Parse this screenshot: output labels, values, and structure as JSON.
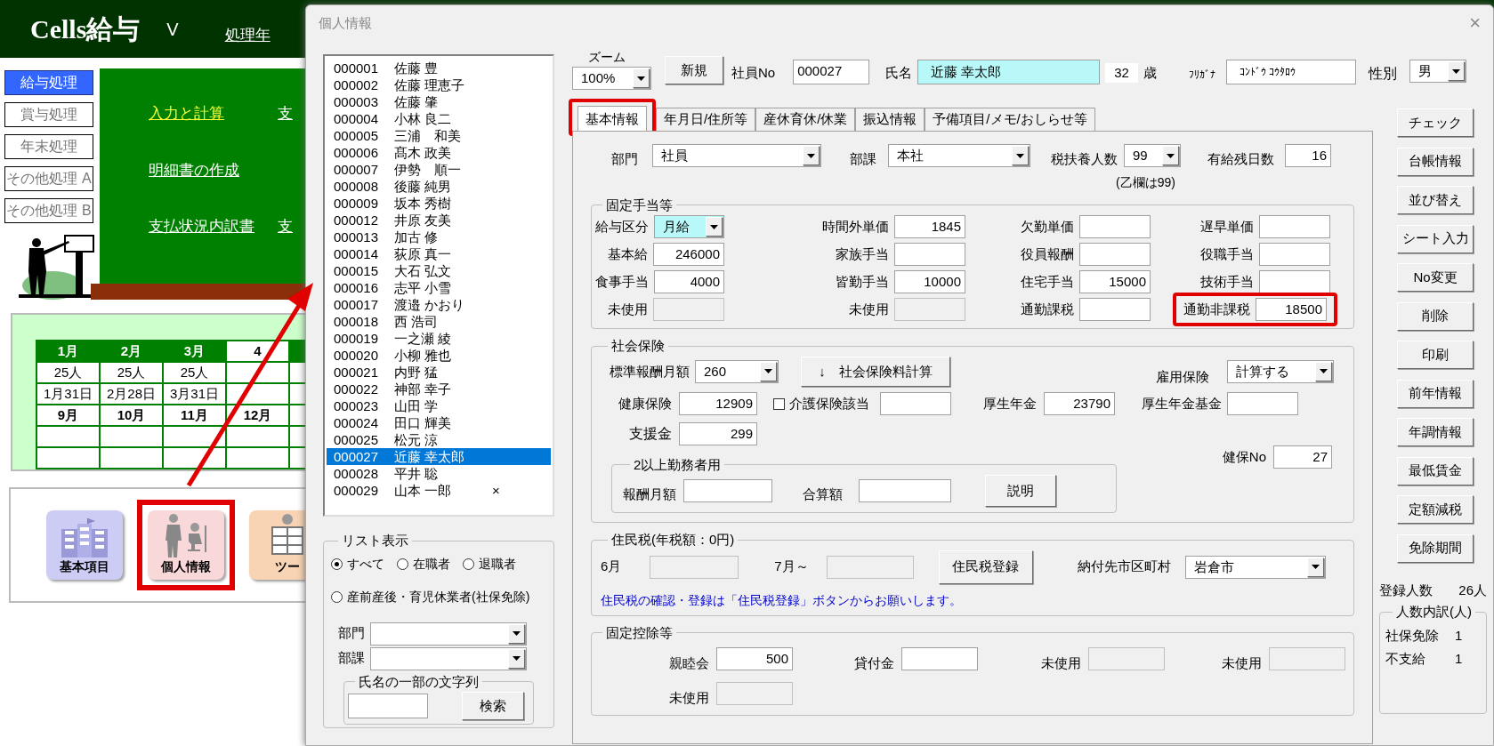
{
  "app": {
    "title": "Cells給与",
    "version_prefix": "V",
    "header_label": "処理年",
    "nav": [
      {
        "label": "給与処理",
        "selected": true
      },
      {
        "label": "賞与処理",
        "selected": false
      },
      {
        "label": "年末処理",
        "selected": false
      },
      {
        "label": "その他処理 A",
        "selected": false
      },
      {
        "label": "その他処理 B",
        "selected": false
      }
    ],
    "menu_rows": [
      {
        "links": [
          {
            "label": "入力と計算",
            "highlighted": true
          },
          {
            "label": "支",
            "highlighted": false
          }
        ]
      },
      {
        "links": [
          {
            "label": "明細書の作成",
            "highlighted": false
          }
        ]
      },
      {
        "links": [
          {
            "label": "支払状況内訳書",
            "highlighted": false
          },
          {
            "label": "支",
            "highlighted": false
          }
        ]
      }
    ],
    "calendar": [
      {
        "kind": "header",
        "cells": [
          {
            "text": "1月",
            "selected": false
          },
          {
            "text": "2月",
            "selected": false
          },
          {
            "text": "3月",
            "selected": false
          },
          {
            "text": "4",
            "selected": true
          }
        ]
      },
      {
        "kind": "data",
        "cells": [
          "25人",
          "25人",
          "25人"
        ]
      },
      {
        "kind": "data",
        "cells": [
          "1月31日",
          "2月28日",
          "3月31日"
        ]
      },
      {
        "kind": "month",
        "cells": [
          "9月",
          "10月",
          "11月",
          "12月"
        ]
      },
      {
        "kind": "blank"
      },
      {
        "kind": "blank"
      }
    ],
    "tools": [
      {
        "label": "基本項目",
        "kind": "building",
        "highlighted": false
      },
      {
        "label": "個人情報",
        "kind": "people",
        "highlighted": true
      },
      {
        "label": "ツー",
        "kind": "worker",
        "highlighted": false
      }
    ]
  },
  "dialog": {
    "title": "個人情報",
    "close": "×",
    "employees": [
      {
        "no": "000001",
        "name": "佐藤 豊",
        "selected": false
      },
      {
        "no": "000002",
        "name": "佐藤 理恵子",
        "selected": false
      },
      {
        "no": "000003",
        "name": "佐藤 肇",
        "selected": false
      },
      {
        "no": "000004",
        "name": "小林 良二",
        "selected": false
      },
      {
        "no": "000005",
        "name": "三浦　和美",
        "selected": false
      },
      {
        "no": "000006",
        "name": "髙木 政美",
        "selected": false
      },
      {
        "no": "000007",
        "name": "伊勢　順一",
        "selected": false
      },
      {
        "no": "000008",
        "name": "後藤 純男",
        "selected": false
      },
      {
        "no": "000009",
        "name": "坂本 秀樹",
        "selected": false
      },
      {
        "no": "000012",
        "name": "井原 友美",
        "selected": false
      },
      {
        "no": "000013",
        "name": "加古 修",
        "selected": false
      },
      {
        "no": "000014",
        "name": "荻原 真一",
        "selected": false
      },
      {
        "no": "000015",
        "name": "大石 弘文",
        "selected": false
      },
      {
        "no": "000016",
        "name": "志平 小雪",
        "selected": false
      },
      {
        "no": "000017",
        "name": "渡邉 かおり",
        "selected": false
      },
      {
        "no": "000018",
        "name": "西 浩司",
        "selected": false
      },
      {
        "no": "000019",
        "name": "一之瀬 綾",
        "selected": false
      },
      {
        "no": "000020",
        "name": "小柳 雅也",
        "selected": false
      },
      {
        "no": "000021",
        "name": "内野 猛",
        "selected": false
      },
      {
        "no": "000022",
        "name": "神部 幸子",
        "selected": false
      },
      {
        "no": "000023",
        "name": "山田 学",
        "selected": false
      },
      {
        "no": "000024",
        "name": "田口 輝美",
        "selected": false
      },
      {
        "no": "000025",
        "name": "松元 涼",
        "selected": false
      },
      {
        "no": "000027",
        "name": "近藤 幸太郎",
        "selected": true
      },
      {
        "no": "000028",
        "name": "平井 聡",
        "selected": false
      },
      {
        "no": "000029",
        "name": "山本 一郎",
        "selected": false,
        "note": "×"
      }
    ],
    "list_filter": {
      "title": "リスト表示",
      "radios": [
        {
          "label": "すべて",
          "selected": true
        },
        {
          "label": "在職者",
          "selected": false
        },
        {
          "label": "退職者",
          "selected": false
        },
        {
          "label": "産前産後・育児休業者(社保免除)",
          "selected": false
        }
      ],
      "department_label": "部門",
      "section_label": "部課",
      "search_title": "氏名の一部の文字列",
      "search_button": "検索"
    },
    "header": {
      "zoom_label": "ズーム",
      "zoom": "100%",
      "new_button": "新規",
      "employee_no_label": "社員No",
      "employee_no": "000027",
      "name_label": "氏名",
      "name": "近藤 幸太郎",
      "age": "32",
      "age_unit": "歳",
      "kana_label": "ﾌﾘｶﾞﾅ",
      "kana": "ｺﾝﾄﾞｳ ｺｳﾀﾛｳ",
      "gender_label": "性別",
      "gender": "男"
    },
    "tabs": [
      {
        "label": "基本情報",
        "selected": true,
        "highlighted": true
      },
      {
        "label": "年月日/住所等",
        "selected": false,
        "highlighted": false
      },
      {
        "label": "産休育休/休業",
        "selected": false,
        "highlighted": false
      },
      {
        "label": "振込情報",
        "selected": false,
        "highlighted": false
      },
      {
        "label": "予備項目/メモ/おしらせ等",
        "selected": false,
        "highlighted": false
      }
    ],
    "basic": {
      "department_label": "部門",
      "department": "社員",
      "section_label": "部課",
      "section": "本社",
      "dependents_label": "税扶養人数",
      "dependents": "99",
      "leave_label": "有給残日数",
      "leave": "16",
      "note": "(乙欄は99)"
    },
    "allowances": {
      "title": "固定手当等",
      "fields": [
        {
          "label": "給与区分",
          "value": "月給",
          "kind": "accent_select",
          "highlighted": false
        },
        {
          "label": "時間外単価",
          "value": "1845",
          "kind": "input",
          "highlighted": false
        },
        {
          "label": "欠勤単価",
          "kind": "input",
          "highlighted": false
        },
        {
          "label": "遅早単価",
          "kind": "input",
          "highlighted": false
        },
        {
          "label": "基本給",
          "value": "246000",
          "kind": "input",
          "highlighted": false
        },
        {
          "label": "家族手当",
          "kind": "input",
          "highlighted": false
        },
        {
          "label": "役員報酬",
          "kind": "input",
          "highlighted": false
        },
        {
          "label": "役職手当",
          "kind": "input",
          "highlighted": false
        },
        {
          "label": "食事手当",
          "value": "4000",
          "kind": "input",
          "highlighted": false
        },
        {
          "label": "皆勤手当",
          "value": "10000",
          "kind": "input",
          "highlighted": false
        },
        {
          "label": "住宅手当",
          "value": "15000",
          "kind": "input",
          "highlighted": false
        },
        {
          "label": "技術手当",
          "kind": "input",
          "highlighted": false
        },
        {
          "label": "未使用",
          "kind": "disabled",
          "highlighted": false
        },
        {
          "label": "未使用",
          "kind": "disabled",
          "highlighted": false
        },
        {
          "label": "通勤課税",
          "kind": "input",
          "highlighted": false
        },
        {
          "label": "通勤非課税",
          "value": "18500",
          "kind": "input",
          "highlighted": true
        }
      ]
    },
    "social_insurance": {
      "title": "社会保険",
      "standard_label": "標準報酬月額",
      "standard": "260",
      "calc_button": "↓　社会保険料計算",
      "employment_label": "雇用保険",
      "employment": "計算する",
      "health_label": "健康保険",
      "health": "12909",
      "care_label": "介護保険該当",
      "care_checked": false,
      "pension_label": "厚生年金",
      "pension": "23790",
      "fund_label": "厚生年金基金",
      "support_label": "支援金",
      "support": "299",
      "multi": {
        "title": "2以上勤務者用",
        "monthly_label": "報酬月額",
        "total_label": "合算額",
        "button": "説明"
      },
      "kenpo_no_label": "健保No",
      "kenpo_no": "27"
    },
    "resident_tax": {
      "title": "住民税(年税額：0円)",
      "june_label": "6月",
      "july_label": "7月～",
      "button": "住民税登録",
      "city_label": "納付先市区町村",
      "city": "岩倉市",
      "note": "住民税の確認・登録は「住民税登録」ボタンからお願いします。"
    },
    "deductions": {
      "title": "固定控除等",
      "fields": [
        {
          "label": "親睦会",
          "value": "500",
          "kind": "input"
        },
        {
          "label": "貸付金",
          "kind": "input"
        },
        {
          "label": "未使用",
          "kind": "disabled"
        },
        {
          "label": "未使用",
          "kind": "disabled"
        },
        {
          "label": "未使用",
          "kind": "disabled"
        }
      ]
    },
    "side_buttons": [
      "チェック",
      "台帳情報",
      "並び替え",
      "シート入力",
      "No変更",
      "削除",
      "印刷",
      "前年情報",
      "年調情報",
      "最低賃金",
      "定額減税",
      "免除期間"
    ],
    "registered": {
      "label": "登録人数",
      "value": "26人"
    },
    "breakdown": {
      "title": "人数内訳(人)",
      "rows": [
        {
          "label": "社保免除",
          "value": "1"
        },
        {
          "label": "不支給",
          "value": "1"
        }
      ]
    }
  }
}
